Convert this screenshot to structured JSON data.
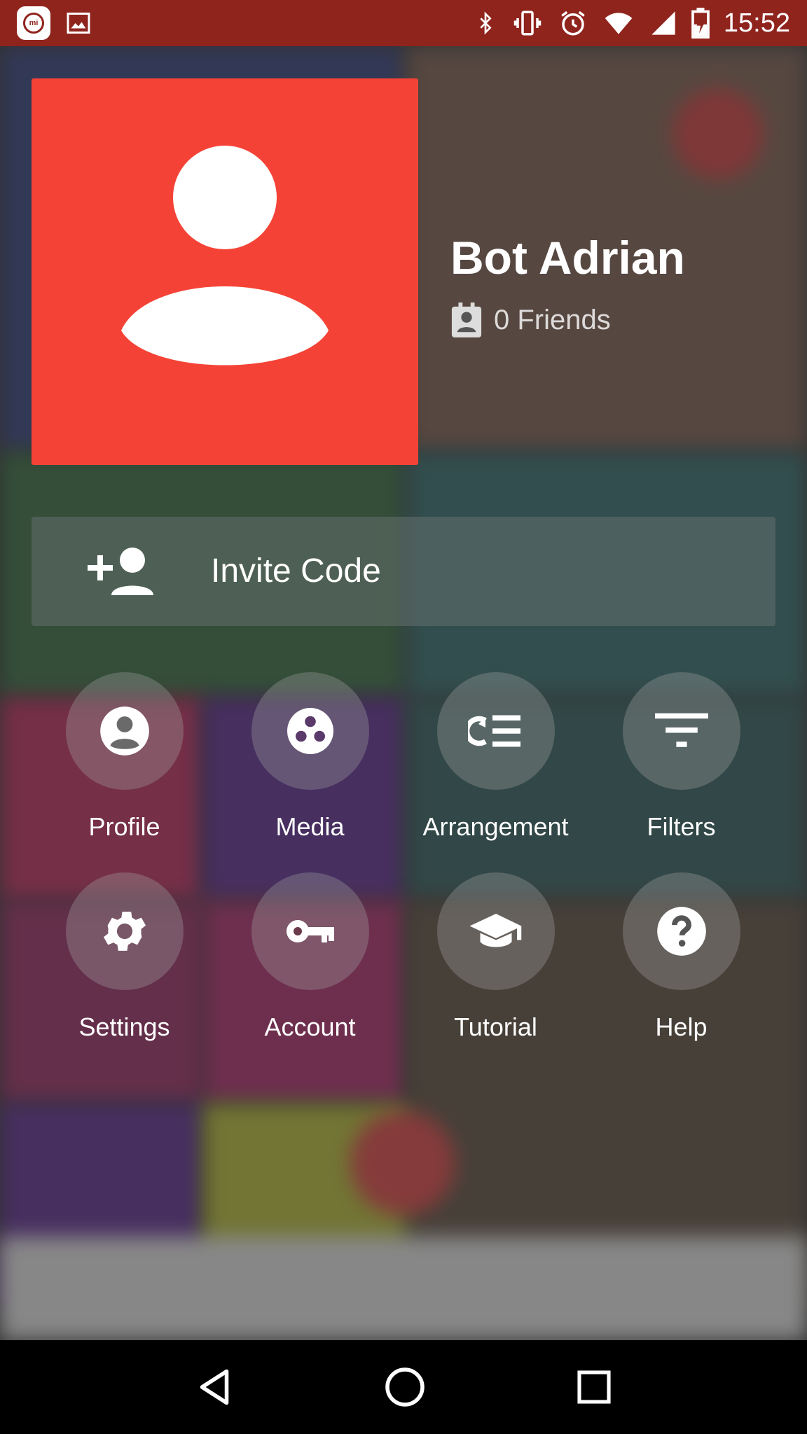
{
  "status_bar": {
    "time": "15:52",
    "icons": [
      "mi-icon",
      "image-icon",
      "bluetooth-icon",
      "vibrate-icon",
      "alarm-icon",
      "wifi-icon",
      "signal-icon",
      "battery-charging-icon"
    ]
  },
  "profile": {
    "name": "Bot Adrian",
    "friends": "0 Friends",
    "avatar_color": "#f44336"
  },
  "invite": {
    "label": "Invite Code"
  },
  "menu": [
    {
      "label": "Profile",
      "icon": "account-circle-icon"
    },
    {
      "label": "Media",
      "icon": "media-icon"
    },
    {
      "label": "Arrangement",
      "icon": "arrangement-icon"
    },
    {
      "label": "Filters",
      "icon": "filter-icon"
    },
    {
      "label": "Settings",
      "icon": "gear-icon"
    },
    {
      "label": "Account",
      "icon": "key-icon"
    },
    {
      "label": "Tutorial",
      "icon": "graduation-cap-icon"
    },
    {
      "label": "Help",
      "icon": "help-icon"
    }
  ],
  "nav_bar": {
    "buttons": [
      "back-icon",
      "home-icon",
      "recents-icon"
    ]
  }
}
